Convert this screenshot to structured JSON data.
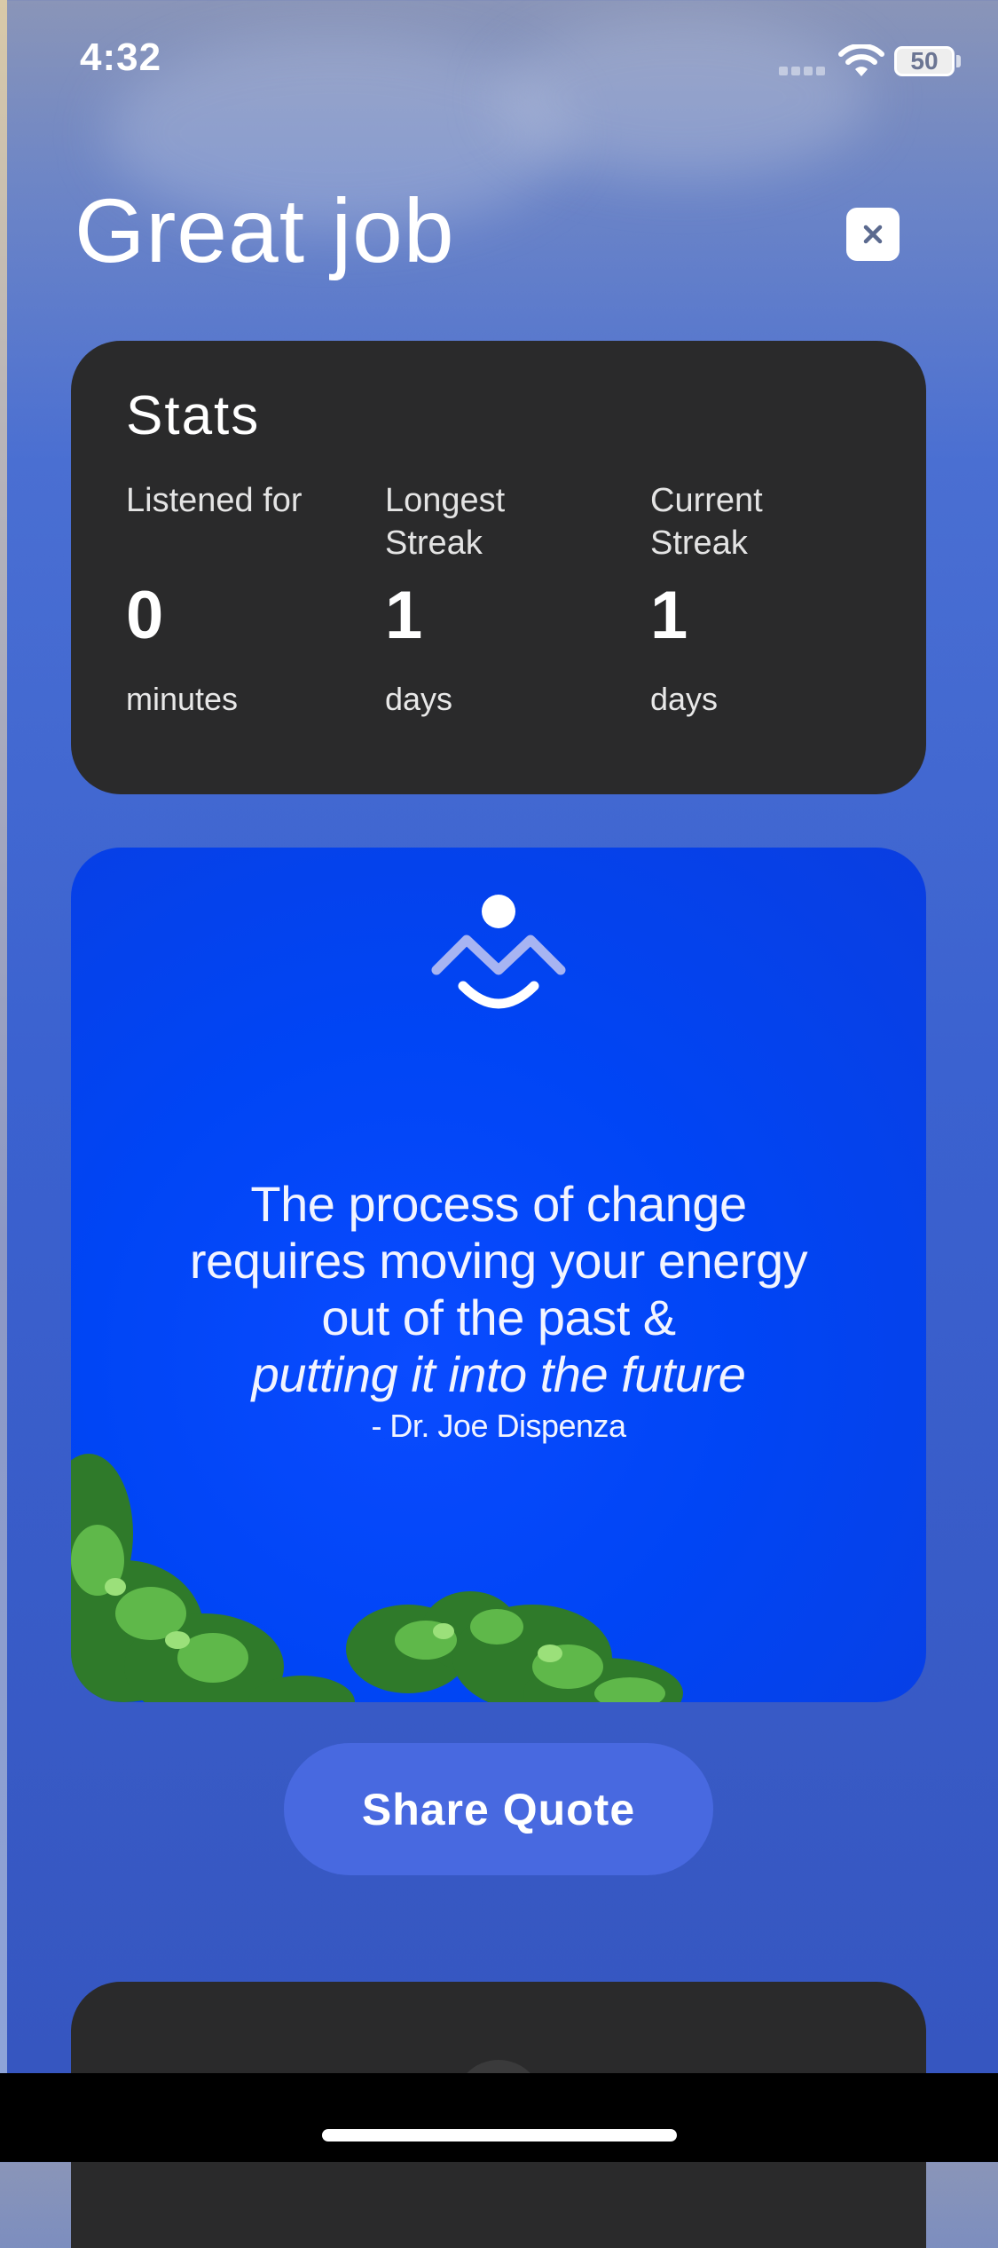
{
  "status_bar": {
    "time": "4:32",
    "battery_level": "50",
    "icons": [
      "cellular-signal-icon",
      "wifi-icon",
      "battery-icon"
    ]
  },
  "header": {
    "title": "Great job",
    "close_icon": "close-icon"
  },
  "stats": {
    "title": "Stats",
    "items": [
      {
        "label": "Listened for",
        "value": "0",
        "unit": "minutes"
      },
      {
        "label": "Longest Streak",
        "value": "1",
        "unit": "days"
      },
      {
        "label": "Current Streak",
        "value": "1",
        "unit": "days"
      }
    ]
  },
  "quote": {
    "logo_icon": "meditation-logo-icon",
    "lines": [
      "The process of change",
      "requires moving your energy",
      "out of the past &"
    ],
    "emphasis": "putting it into the future",
    "author": "- Dr. Joe Dispenza"
  },
  "actions": {
    "share_label": "Share Quote"
  },
  "colors": {
    "card_dark": "#2a2a2b",
    "quote_blue": "#0045f5",
    "button_blue": "#4869e0",
    "background_blue": "#3b62d0"
  }
}
